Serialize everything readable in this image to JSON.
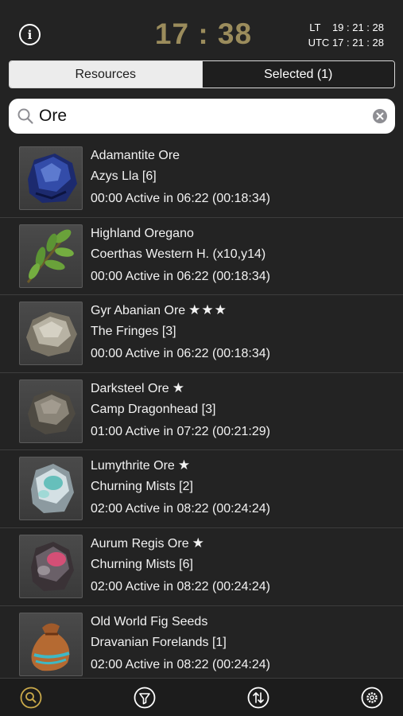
{
  "header": {
    "local_time": "17 : 38",
    "lt_label": "LT",
    "lt_value": "19 : 21 : 28",
    "utc_label": "UTC",
    "utc_value": "17 : 21 : 28"
  },
  "segments": {
    "resources": "Resources",
    "selected": "Selected (1)"
  },
  "search": {
    "value": "Ore"
  },
  "items": [
    {
      "name": "Adamantite Ore",
      "stars": "",
      "location": "Azys Lla [6]",
      "time": "00:00 Active in 06:22 (00:18:34)",
      "icon": "adamantite-ore-icon"
    },
    {
      "name": "Highland Oregano",
      "stars": "",
      "location": "Coerthas Western H. (x10,y14)",
      "time": "00:00 Active in 06:22 (00:18:34)",
      "icon": "highland-oregano-icon"
    },
    {
      "name": "Gyr Abanian Ore",
      "stars": "★★★",
      "location": "The Fringes [3]",
      "time": "00:00 Active in 06:22 (00:18:34)",
      "icon": "gyr-abanian-ore-icon"
    },
    {
      "name": "Darksteel Ore",
      "stars": "★",
      "location": "Camp Dragonhead [3]",
      "time": "01:00 Active in 07:22 (00:21:29)",
      "icon": "darksteel-ore-icon"
    },
    {
      "name": "Lumythrite Ore",
      "stars": "★",
      "location": "Churning Mists [2]",
      "time": "02:00 Active in 08:22 (00:24:24)",
      "icon": "lumythrite-ore-icon"
    },
    {
      "name": "Aurum Regis Ore",
      "stars": "★",
      "location": "Churning Mists [6]",
      "time": "02:00 Active in 08:22 (00:24:24)",
      "icon": "aurum-regis-ore-icon"
    },
    {
      "name": "Old World Fig Seeds",
      "stars": "",
      "location": "Dravanian Forelands [1]",
      "time": "02:00 Active in 08:22 (00:24:24)",
      "icon": "fig-seeds-icon"
    }
  ],
  "tabbar": {
    "tabs": [
      "search-tab",
      "filter-tab",
      "sort-tab",
      "settings-tab"
    ]
  },
  "colors": {
    "clock_gold": "#9b8c5c",
    "background": "#232323",
    "tab_active": "#c9a94a"
  }
}
